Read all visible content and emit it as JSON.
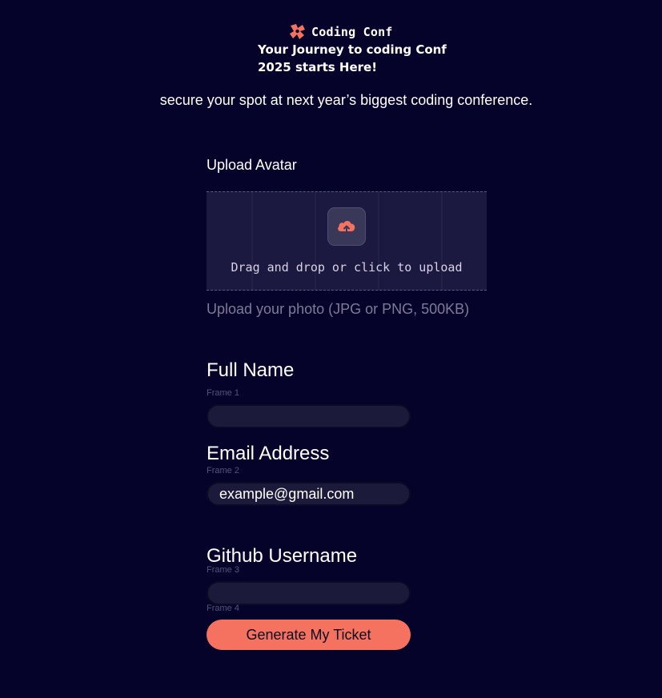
{
  "header": {
    "brand": "Coding Conf",
    "logo_icon": "coding-conf-logo-icon",
    "headline_line1": "Your Journey to coding Conf",
    "headline_line2": "2025 starts Here!",
    "subtitle": "secure your spot at next year’s biggest coding conference."
  },
  "upload": {
    "label": "Upload Avatar",
    "icon": "cloud-upload-icon",
    "prompt": "Drag and drop or click to upload",
    "hint": "Upload your photo (JPG or PNG, 500KB)"
  },
  "fields": {
    "full_name": {
      "label": "Full Name",
      "frame": "Frame 1",
      "value": ""
    },
    "email": {
      "label": "Email Address",
      "frame": "Frame 2",
      "placeholder": "example@gmail.com"
    },
    "github": {
      "label": "Github Username",
      "frame": "Frame 3",
      "value": ""
    },
    "submit_frame": "Frame 4"
  },
  "submit_label": "Generate My Ticket",
  "colors": {
    "background": "#05032a",
    "accent": "#f57261",
    "input_bg": "#1b1a3a",
    "muted_text": "#7d7b96"
  }
}
